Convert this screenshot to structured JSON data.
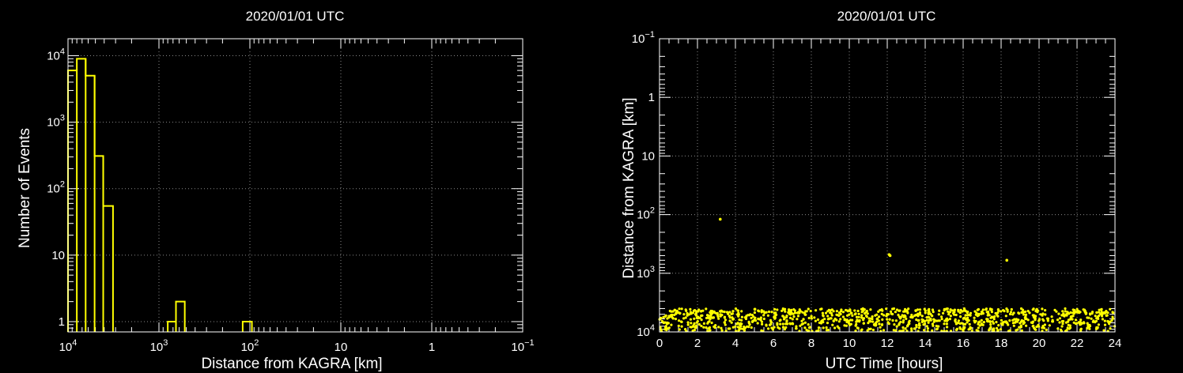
{
  "colors": {
    "background": "#000000",
    "axes": "#ffffff",
    "series": "#ffff00",
    "grid": "#8a8a8a"
  },
  "chart_data": [
    {
      "type": "bar",
      "subtype": "step-histogram",
      "title": "2020/01/01 UTC",
      "xlabel": "Distance from KAGRA [km]",
      "ylabel": "Number of Events",
      "xscale": "log",
      "xreversed": true,
      "xlim": [
        10000,
        0.1
      ],
      "yscale": "log",
      "ylim": [
        0.7,
        18000
      ],
      "grid": true,
      "x_ticks": [
        {
          "v": 10000,
          "base": "10",
          "exp": "4"
        },
        {
          "v": 1000,
          "base": "10",
          "exp": "3"
        },
        {
          "v": 100,
          "base": "10",
          "exp": "2"
        },
        {
          "v": 10,
          "base": "10",
          "exp": ""
        },
        {
          "v": 1,
          "base": "1",
          "exp": ""
        },
        {
          "v": 0.1,
          "base": "10",
          "exp": "−1"
        }
      ],
      "y_ticks": [
        {
          "v": 10000,
          "base": "10",
          "exp": "4"
        },
        {
          "v": 1000,
          "base": "10",
          "exp": "3"
        },
        {
          "v": 100,
          "base": "10",
          "exp": "2"
        },
        {
          "v": 10,
          "base": "10",
          "exp": ""
        },
        {
          "v": 1,
          "base": "1",
          "exp": ""
        }
      ],
      "bins": [
        {
          "x0": 10000,
          "x1": 8000,
          "count": 6000
        },
        {
          "x0": 8000,
          "x1": 6400,
          "count": 9000
        },
        {
          "x0": 6400,
          "x1": 5100,
          "count": 5000
        },
        {
          "x0": 5100,
          "x1": 4100,
          "count": 310
        },
        {
          "x0": 4100,
          "x1": 3200,
          "count": 55
        },
        {
          "x0": 800,
          "x1": 650,
          "count": 1
        },
        {
          "x0": 650,
          "x1": 520,
          "count": 2
        },
        {
          "x0": 120,
          "x1": 95,
          "count": 1
        }
      ]
    },
    {
      "type": "scatter",
      "title": "2020/01/01 UTC",
      "xlabel": "UTC Time [hours]",
      "ylabel": "Distance from KAGRA [km]",
      "xlim": [
        0,
        24
      ],
      "yscale": "log",
      "yreversed": true,
      "ylim": [
        0.1,
        10000
      ],
      "grid": true,
      "x_ticks": [
        "0",
        "2",
        "4",
        "6",
        "8",
        "10",
        "12",
        "14",
        "16",
        "18",
        "20",
        "22",
        "24"
      ],
      "y_ticks": [
        {
          "v": 0.1,
          "base": "10",
          "exp": "−1"
        },
        {
          "v": 1,
          "base": "1",
          "exp": ""
        },
        {
          "v": 10,
          "base": "10",
          "exp": ""
        },
        {
          "v": 100,
          "base": "10",
          "exp": "2"
        },
        {
          "v": 1000,
          "base": "10",
          "exp": "3"
        },
        {
          "v": 10000,
          "base": "10",
          "exp": "4"
        }
      ],
      "outliers": [
        {
          "x": 3.2,
          "y": 120
        },
        {
          "x": 12.1,
          "y": 480
        },
        {
          "x": 12.15,
          "y": 500
        },
        {
          "x": 18.3,
          "y": 600
        }
      ],
      "dense_band": {
        "x_range": [
          0,
          24
        ],
        "y_range": [
          4000,
          10000
        ],
        "approx_points": 1100
      }
    }
  ]
}
